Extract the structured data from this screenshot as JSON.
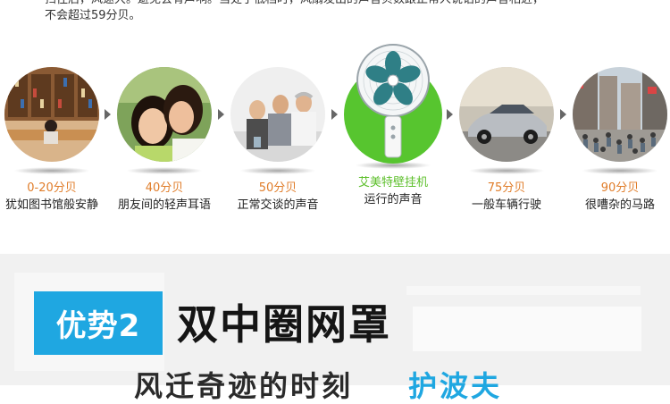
{
  "intro": {
    "line1": "扫往后，风速大。避免会有声响。当处于低档时，风扇发出的声音贝数跟正常人说话的声音相近，",
    "line2": "不会超过59分贝。"
  },
  "levels": [
    {
      "db": "0-20分贝",
      "desc": "犹如图书馆般安静",
      "color": "#e07d2a"
    },
    {
      "db": "40分贝",
      "desc": "朋友间的轻声耳语",
      "color": "#e07d2a"
    },
    {
      "db": "50分贝",
      "desc": "正常交谈的声音",
      "color": "#e07d2a"
    },
    {
      "db": "艾美特壁挂机",
      "desc": "运行的声音",
      "color": "#5cbf2a"
    },
    {
      "db": "75分贝",
      "desc": "一般车辆行驶",
      "color": "#e07d2a"
    },
    {
      "db": "90分贝",
      "desc": "很嘈杂的马路",
      "color": "#e07d2a"
    }
  ],
  "section2": {
    "badge": "优势2",
    "title": "双中圈网罩",
    "subtitle": "风迁奇迹的时刻",
    "subtitle_highlight": "护波夫"
  },
  "colors": {
    "accent_blue": "#1fa7e1",
    "accent_green": "#5cbf2a",
    "db_orange": "#e07d2a"
  }
}
